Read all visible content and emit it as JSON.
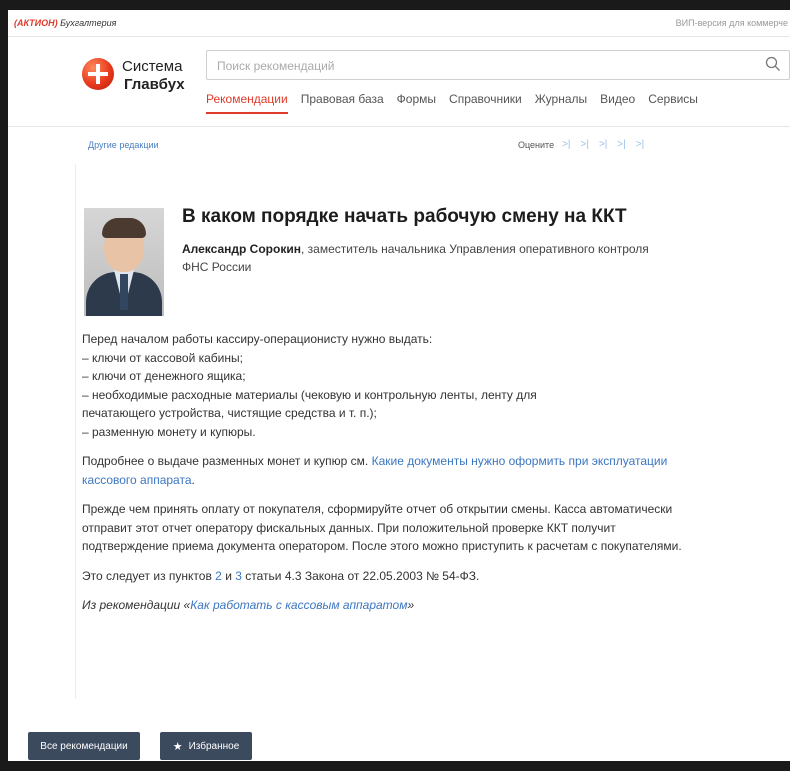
{
  "topbar": {
    "brand_part1": "(АКТИОН)",
    "brand_part2": "Бухгалтерия",
    "vip_link": "ВИП-версия для коммерче"
  },
  "header": {
    "logo_line1": "Система",
    "logo_line2": "Главбух",
    "search_placeholder": "Поиск рекомендаций",
    "nav": [
      {
        "label": "Рекомендации",
        "active": true
      },
      {
        "label": "Правовая база",
        "active": false
      },
      {
        "label": "Формы",
        "active": false
      },
      {
        "label": "Справочники",
        "active": false
      },
      {
        "label": "Журналы",
        "active": false
      },
      {
        "label": "Видео",
        "active": false
      },
      {
        "label": "Сервисы",
        "active": false
      }
    ]
  },
  "subbar": {
    "other_editions": "Другие редакции",
    "rate_label": "Оцените"
  },
  "article": {
    "title": "В каком порядке начать рабочую смену на ККТ",
    "author_name": "Александр Сорокин",
    "author_role": ", заместитель начальника Управления оперативного контроля ФНС России",
    "p1_intro": "Перед началом работы кассиру-операционисту нужно выдать:",
    "p1_item1": "– ключи от кассовой кабины;",
    "p1_item2": "– ключи от денежного ящика;",
    "p1_item3a": "– необходимые расходные материалы (чековую и контрольную ленты, ленту для",
    "p1_item3b": "печатающего устройства, чистящие средства и т. п.);",
    "p1_item4": "– разменную монету и купюры.",
    "p2_text": "Подробнее о выдаче разменных монет и купюр см. ",
    "p2_link": "Какие документы нужно оформить при эксплуатации кассового аппарата",
    "p2_end": ".",
    "p3_text": "Прежде чем принять оплату от покупателя, сформируйте отчет об открытии смены. Касса автоматически отправит этот отчет оператору фискальных данных. При положительной проверке ККТ получит подтверждение приема документа оператором. После этого можно приступить к расчетам с покупателями.",
    "p4_a": "Это следует из пунктов ",
    "p4_link1": "2",
    "p4_b": " и ",
    "p4_link2": "3",
    "p4_c": " статьи 4.3 Закона от 22.05.2003 № 54-ФЗ.",
    "p5_a": "Из рекомендации «",
    "p5_link": "Как работать с кассовым аппаратом",
    "p5_b": "»"
  },
  "footer": {
    "all_recommendations": "Все рекомендации",
    "favorites": "Избранное"
  },
  "colors": {
    "accent": "#e03a2a",
    "link": "#3b76c2",
    "button": "#3c4a5e"
  }
}
